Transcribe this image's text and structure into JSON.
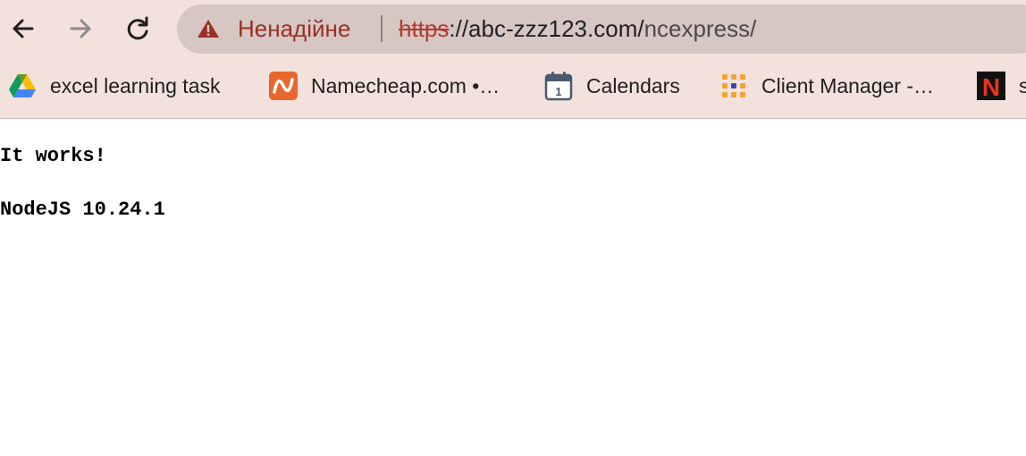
{
  "browser": {
    "security_label": "Ненадійне",
    "url_scheme": "https",
    "url_host": "://abc-zzz123.com/",
    "url_path": "ncexpress/",
    "bookmarks": [
      {
        "label": "excel learning task",
        "icon": "google-drive-icon"
      },
      {
        "label": "Namecheap.com •…",
        "icon": "namecheap-icon"
      },
      {
        "label": "Calendars",
        "icon": "calendar-icon"
      },
      {
        "label": "Client Manager -…",
        "icon": "grid-dots-icon"
      },
      {
        "label": "s",
        "icon": "netflix-n-icon"
      }
    ],
    "calendar_day": "1",
    "netflix_letter": "N",
    "colors": {
      "chrome_bg": "#f3e1dc",
      "omnibox_bg": "#d6c7c3",
      "warning": "#9a2f27"
    }
  },
  "page": {
    "line1": "It works!",
    "line2": "NodeJS 10.24.1"
  }
}
